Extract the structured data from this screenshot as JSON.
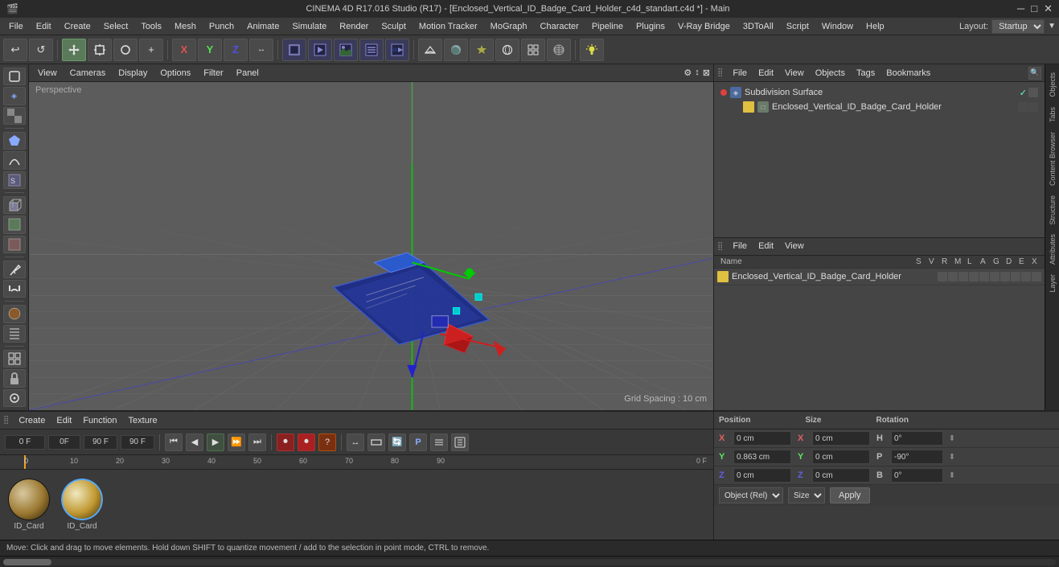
{
  "titlebar": {
    "title": "CINEMA 4D R17.016 Studio (R17) - [Enclosed_Vertical_ID_Badge_Card_Holder_c4d_standart.c4d *] - Main",
    "minimize": "─",
    "maximize": "□",
    "close": "✕"
  },
  "menubar": {
    "items": [
      "File",
      "Edit",
      "Create",
      "Select",
      "Tools",
      "Mesh",
      "Punch",
      "Animate",
      "Simulate",
      "Render",
      "Sculpt",
      "Motion Tracker",
      "MoGraph",
      "Character",
      "Pipeline",
      "Plugins",
      "V-Ray Bridge",
      "3DToAll",
      "Script",
      "Window",
      "Help"
    ],
    "layout_label": "Layout:",
    "layout_value": "Startup"
  },
  "toolbar": {
    "undo_label": "↩",
    "redo_label": "↪"
  },
  "viewport": {
    "label": "Perspective",
    "view_menu": "View",
    "cameras_menu": "Cameras",
    "display_menu": "Display",
    "options_menu": "Options",
    "filter_menu": "Filter",
    "panel_menu": "Panel",
    "grid_spacing": "Grid Spacing : 10 cm"
  },
  "object_manager": {
    "file_menu": "File",
    "edit_menu": "Edit",
    "view_menu": "View",
    "objects_menu": "Objects",
    "tags_menu": "Tags",
    "bookmarks_menu": "Bookmarks",
    "items": [
      {
        "name": "Subdivision Surface",
        "dot_color": "#e04040",
        "has_check": true
      },
      {
        "name": "Enclosed_Vertical_ID_Badge_Card_Holder",
        "dot_color": "#888",
        "color_square": "#e0c040"
      }
    ]
  },
  "attribute_manager": {
    "file_menu": "File",
    "edit_menu": "Edit",
    "view_menu": "View",
    "name_header": "Name",
    "s_header": "S",
    "v_header": "V",
    "r_header": "R",
    "m_header": "M",
    "l_header": "L",
    "a_header": "A",
    "g_header": "G",
    "d_header": "D",
    "e_header": "E",
    "x_header": "X",
    "items": [
      {
        "name": "Enclosed_Vertical_ID_Badge_Card_Holder",
        "color": "#e0c040"
      }
    ]
  },
  "timeline": {
    "current_frame": "0 F",
    "start_frame": "0F",
    "input_frame": "0F",
    "end_frame": "90 F",
    "fps_frame": "90 F",
    "ticks": [
      0,
      10,
      20,
      30,
      40,
      50,
      60,
      70,
      80,
      90
    ],
    "frame_indicator": "0 F"
  },
  "material_editor": {
    "create_menu": "Create",
    "edit_menu": "Edit",
    "function_menu": "Function",
    "texture_menu": "Texture",
    "materials": [
      {
        "id": "mat1",
        "label": "ID_Card",
        "type": "standard"
      },
      {
        "id": "mat2",
        "label": "ID_Card",
        "type": "metal"
      }
    ]
  },
  "coordinates": {
    "position_label": "Position",
    "size_label": "Size",
    "rotation_label": "Rotation",
    "x_pos": "0 cm",
    "y_pos": "0.863 cm",
    "z_pos": "0 cm",
    "x_size": "0 cm",
    "y_size": "0 cm",
    "z_size": "0 cm",
    "h_rot": "0°",
    "p_rot": "-90°",
    "b_rot": "0°",
    "x_label": "X",
    "y_label": "Y",
    "z_label": "Z",
    "h_label": "H",
    "p_label": "P",
    "b_label": "B",
    "coord_mode": "Object (Rel)",
    "size_mode": "Size",
    "apply_btn": "Apply"
  },
  "statusbar": {
    "text": "Move: Click and drag to move elements. Hold down SHIFT to quantize movement / add to the selection in point mode, CTRL to remove."
  },
  "playback": {
    "goto_start": "⏮",
    "prev_frame": "◀",
    "play": "▶",
    "next_frame": "▶",
    "goto_end": "⏭",
    "record": "●"
  }
}
